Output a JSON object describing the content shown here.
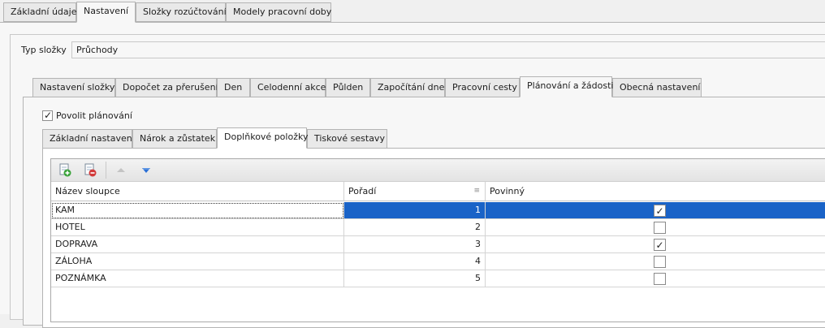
{
  "top_tabs": [
    "Základní údaje",
    "Nastavení",
    "Složky rozúčtování",
    "Modely pracovní doby"
  ],
  "top_active": 1,
  "typ_slozky": {
    "label": "Typ složky",
    "value": "Průchody"
  },
  "mid_tabs": [
    "Nastavení složky",
    "Dopočet za přerušení",
    "Den",
    "Celodenní akce",
    "Půlden",
    "Započítání dne",
    "Pracovní cesty",
    "Plánování a žádosti",
    "Obecná nastavení"
  ],
  "mid_active": 7,
  "povolit": {
    "label": "Povolit plánování",
    "checked": true
  },
  "low_tabs": [
    "Základní nastavení",
    "Nárok a zůstatek",
    "Doplňkové položky",
    "Tiskové sestavy"
  ],
  "low_active": 2,
  "toolbar": {
    "add_icon": "add-row-icon",
    "remove_icon": "remove-row-icon",
    "up_icon": "move-up-icon",
    "down_icon": "move-down-icon"
  },
  "grid": {
    "headers": {
      "name": "Název sloupce",
      "order": "Pořadí",
      "required": "Povinný"
    },
    "rows": [
      {
        "name": "KAM",
        "order": "1",
        "required": true,
        "selected": true
      },
      {
        "name": "HOTEL",
        "order": "2",
        "required": false,
        "selected": false
      },
      {
        "name": "DOPRAVA",
        "order": "3",
        "required": true,
        "selected": false
      },
      {
        "name": "ZÁLOHA",
        "order": "4",
        "required": false,
        "selected": false
      },
      {
        "name": "POZNÁMKA",
        "order": "5",
        "required": false,
        "selected": false
      }
    ]
  },
  "colors": {
    "selection": "#1a63c7",
    "border": "#b4b4b4"
  }
}
